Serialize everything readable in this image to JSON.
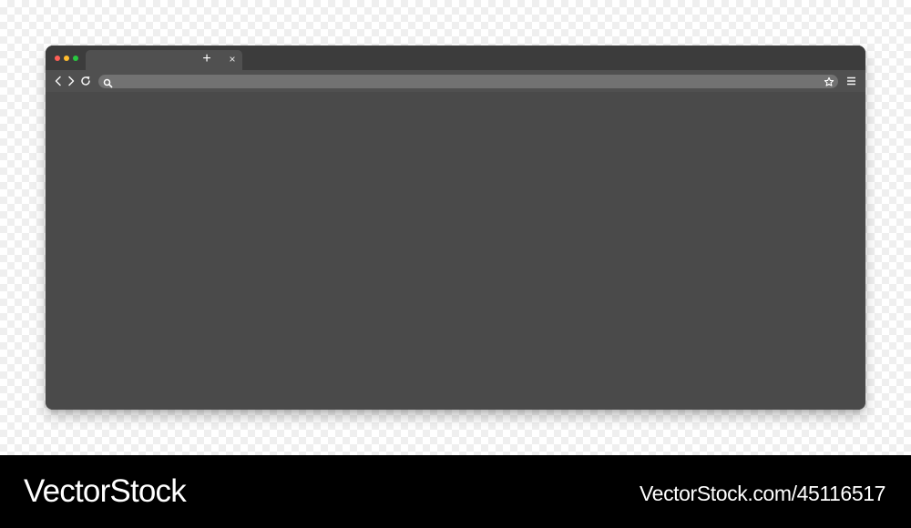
{
  "browser": {
    "window_controls": [
      {
        "name": "close",
        "color": "#ff5f57"
      },
      {
        "name": "minimize",
        "color": "#febc2e"
      },
      {
        "name": "zoom",
        "color": "#28c840"
      }
    ],
    "tab": {
      "title": "",
      "close_icon": "close-icon",
      "close_glyph": "×"
    },
    "new_tab": {
      "icon": "plus-icon",
      "glyph": "+"
    },
    "toolbar": {
      "back_icon": "chevron-left-icon",
      "forward_icon": "chevron-right-icon",
      "reload_icon": "reload-icon",
      "address_bar": {
        "value": "",
        "placeholder": "",
        "search_icon": "search-icon",
        "bookmark_icon": "star-icon"
      },
      "menu_icon": "hamburger-menu-icon"
    },
    "colors": {
      "window": "#4a4a4a",
      "tab_strip": "#3c3c3c",
      "toolbar": "#505050",
      "address_bar": "#727272"
    }
  },
  "watermark": {
    "logo": "VectorStock",
    "url": "VectorStock.com/45116517"
  }
}
